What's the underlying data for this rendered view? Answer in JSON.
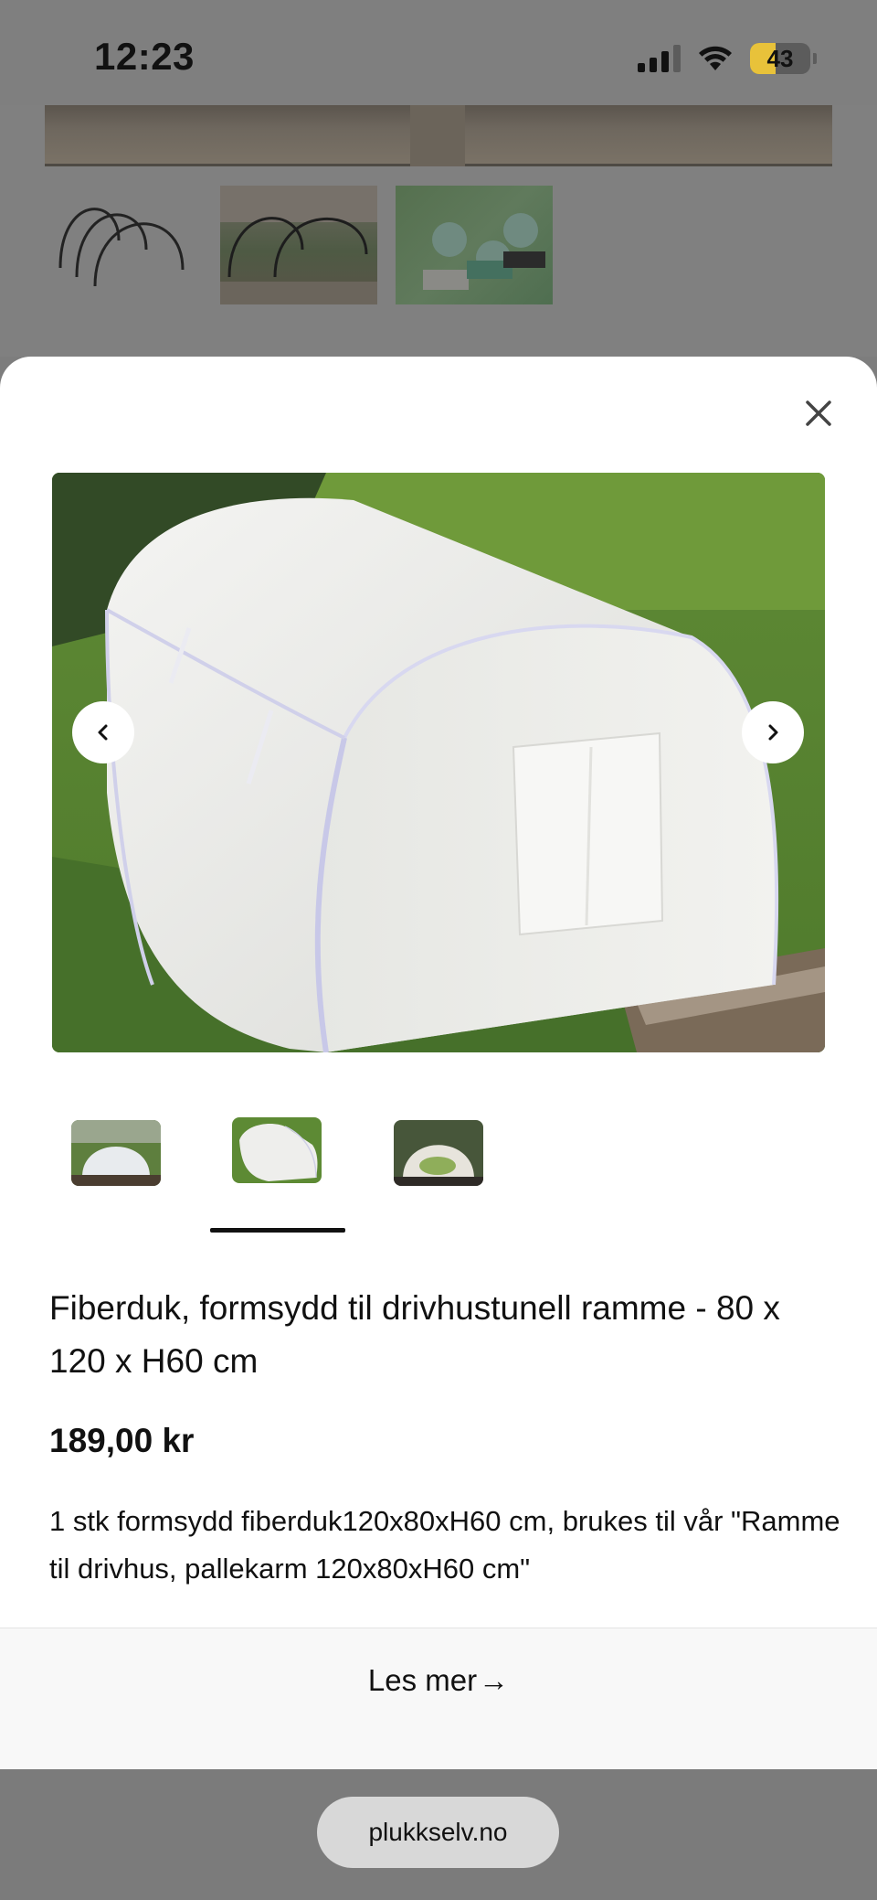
{
  "status_bar": {
    "time": "12:23",
    "battery": "43",
    "icons": [
      "cellular-signal-icon",
      "wifi-icon",
      "battery-icon"
    ]
  },
  "background_page": {
    "gallery": [
      "garden-bed-image",
      "hoop-frame-image",
      "raised-bed-image",
      "fabric-colors-image"
    ]
  },
  "modal": {
    "close_icon": "close-icon",
    "carousel": {
      "prev_icon": "chevron-left-icon",
      "next_icon": "chevron-right-icon",
      "selected_index": 1,
      "thumbnails": [
        "tunnel-front-image",
        "tunnel-side-image",
        "tunnel-plants-image"
      ]
    },
    "product": {
      "title": "Fiberduk, formsydd til drivhustunell ramme - 80 x 120 x H60 cm",
      "price": "189,00 kr",
      "description": "1 stk formsydd fiberduk120x80xH60 cm, brukes til vår \"Ramme til drivhus, pallekarm 120x80xH60 cm\""
    },
    "read_more": {
      "label": "Les mer",
      "arrow": "→"
    }
  },
  "browser": {
    "url": "plukkselv.no"
  },
  "colors": {
    "overlay": "#7f7f7f",
    "sheet": "#ffffff",
    "text": "#111111",
    "battery_accent": "#e8c23a"
  }
}
